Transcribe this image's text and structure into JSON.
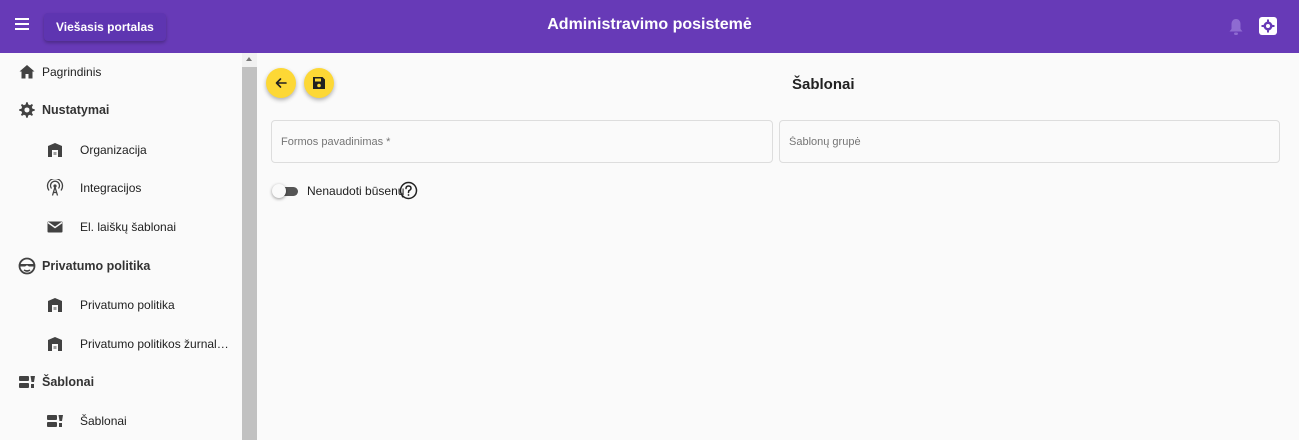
{
  "header": {
    "menu_icon": "menu-icon",
    "portal_button": "Viešasis portalas",
    "title": "Administravimo posistemė",
    "icons": [
      "bell-icon",
      "settings-icon"
    ]
  },
  "sidebar": {
    "items": [
      {
        "label": "Pagrindinis",
        "icon": "home-icon"
      },
      {
        "label": "Nustatymai",
        "icon": "gear-icon"
      },
      {
        "label": "Organizacija",
        "icon": "building-icon"
      },
      {
        "label": "Integracijos",
        "icon": "antenna-icon"
      },
      {
        "label": "El. laiškų šablonai",
        "icon": "mail-icon"
      },
      {
        "label": "Privatumo politika",
        "icon": "privacy-icon"
      },
      {
        "label": "Privatumo politika",
        "icon": "building-icon"
      },
      {
        "label": "Privatumo politikos žurnal…",
        "icon": "building-icon"
      },
      {
        "label": "Šablonai",
        "icon": "template-icon"
      },
      {
        "label": "Šablonai",
        "icon": "template-icon"
      }
    ]
  },
  "main": {
    "title": "Šablonai",
    "back_icon": "arrow-back-icon",
    "save_icon": "save-icon",
    "form_name_placeholder": "Formos pavadinimas *",
    "form_name_value": "",
    "group_placeholder": "Šablonų grupė",
    "group_value": "",
    "toggle_label": "Nenaudoti būsenų",
    "toggle_on": false,
    "help_icon": "help-circle-icon"
  },
  "colors": {
    "primary": "#673ab7",
    "accent": "#fdd835"
  }
}
